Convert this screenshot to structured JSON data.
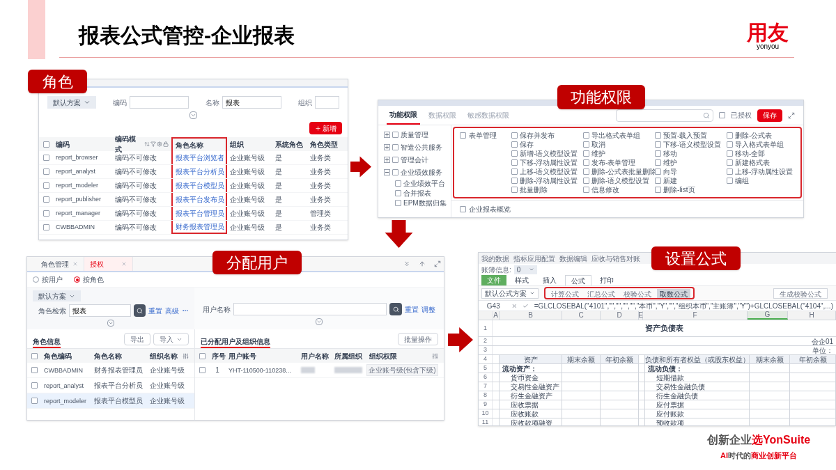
{
  "slide": {
    "title": "报表公式管控-企业报表",
    "logo": {
      "mark": "用友",
      "word": "yonyou"
    },
    "slogan": [
      [
        {
          "text": "创新企业",
          "accent": false
        },
        {
          "text": "选YonSuite",
          "accent": true
        }
      ],
      [
        {
          "text": "AI",
          "accent": true
        },
        {
          "text": "时代的",
          "accent": false
        },
        {
          "text": "商业创新平台",
          "accent": true
        }
      ]
    ]
  },
  "roles": {
    "label": "角色",
    "scheme": "默认方案",
    "filters": [
      {
        "label": "编码"
      },
      {
        "label": "名称",
        "value": "报表"
      },
      {
        "label": "组织"
      }
    ],
    "add_button": "新增",
    "all_checked": false,
    "columns": [
      "编码",
      "编码模式",
      "角色名称",
      "组织",
      "系统角色",
      "角色类型"
    ],
    "rows": [
      {
        "checked": false,
        "cells": [
          "report_browser",
          "编码不可修改",
          "报表平台浏览者",
          "企业账号级",
          "是",
          "业务类"
        ]
      },
      {
        "checked": false,
        "cells": [
          "report_analyst",
          "编码不可修改",
          "报表平台分析员",
          "企业账号级",
          "是",
          "业务类"
        ]
      },
      {
        "checked": false,
        "cells": [
          "report_modeler",
          "编码不可修改",
          "报表平台模型员",
          "企业账号级",
          "是",
          "业务类"
        ]
      },
      {
        "checked": false,
        "cells": [
          "report_publisher",
          "编码不可修改",
          "报表平台发布员",
          "企业账号级",
          "是",
          "业务类"
        ]
      },
      {
        "checked": false,
        "cells": [
          "report_manager",
          "编码不可修改",
          "报表平台管理员",
          "企业账号级",
          "是",
          "管理类"
        ]
      },
      {
        "checked": false,
        "cells": [
          "CWBBADMIN",
          "编码不可修改",
          "财务报表管理员",
          "企业账号级",
          "是",
          "业务类"
        ]
      }
    ]
  },
  "permissions": {
    "label": "功能权限",
    "tabs": [
      {
        "label": "功能权限",
        "selected": true
      },
      {
        "label": "数据权限",
        "selected": false
      },
      {
        "label": "敏感数据权限",
        "selected": false
      }
    ],
    "authorized_label": "已授权",
    "authorized_checked": false,
    "save_button": "保存",
    "tree": [
      {
        "label": "质量管理",
        "expanded": false,
        "checked": false
      },
      {
        "label": "智造公共服务",
        "expanded": false,
        "checked": false
      },
      {
        "label": "管理会计",
        "expanded": false,
        "checked": false
      },
      {
        "label": "企业绩效服务",
        "expanded": true,
        "checked": false,
        "children": [
          {
            "label": "企业绩效平台",
            "checked": false
          },
          {
            "label": "合并报表",
            "checked": false
          },
          {
            "label": "EPM数据归集",
            "checked": false
          }
        ]
      }
    ],
    "group": {
      "label": "表单管理",
      "checked": false,
      "columns": [
        [
          {
            "label": "保存并发布",
            "checked": false
          },
          {
            "label": "保存",
            "checked": false
          },
          {
            "label": "新增-语义模型设置",
            "checked": false
          },
          {
            "label": "下移-浮动属性设置",
            "checked": false
          },
          {
            "label": "上移-语义模型设置",
            "checked": false
          },
          {
            "label": "删除-浮动属性设置",
            "checked": false
          },
          {
            "label": "批量删除",
            "checked": false
          }
        ],
        [
          {
            "label": "导出格式表单组",
            "checked": false
          },
          {
            "label": "取消",
            "checked": false
          },
          {
            "label": "维护",
            "checked": false
          },
          {
            "label": "发布-表单管理",
            "checked": false
          },
          {
            "label": "删除-公式表批量删除",
            "checked": false
          },
          {
            "label": "删除-语义模型设置",
            "checked": false
          },
          {
            "label": "信息修改",
            "checked": false
          }
        ],
        [
          {
            "label": "预置-载入预置",
            "checked": false
          },
          {
            "label": "下移-语义模型设置",
            "checked": false
          },
          {
            "label": "移动",
            "checked": false
          },
          {
            "label": "维护",
            "checked": false
          },
          {
            "label": "向导",
            "checked": false
          },
          {
            "label": "新建",
            "checked": false
          },
          {
            "label": "删除-list页",
            "checked": false
          }
        ],
        [
          {
            "label": "删除-公式表",
            "checked": false
          },
          {
            "label": "导入格式表单组",
            "checked": false
          },
          {
            "label": "移动-全部",
            "checked": false
          },
          {
            "label": "新建格式表",
            "checked": false
          },
          {
            "label": "上移-浮动属性设置",
            "checked": false
          },
          {
            "label": "编组",
            "checked": false
          }
        ]
      ]
    },
    "next_group": {
      "label": "企业报表概览",
      "checked": false
    }
  },
  "assign": {
    "label": "分配用户",
    "tabs": [
      {
        "label": "角色管理",
        "selected": false
      },
      {
        "label": "授权",
        "selected": true
      }
    ],
    "modes": [
      {
        "label": "按用户",
        "selected": false
      },
      {
        "label": "按角色",
        "selected": true
      }
    ],
    "scheme": "默认方案",
    "role_search": {
      "label": "角色检索",
      "value": "报表"
    },
    "left_links": [
      "重置",
      "高级"
    ],
    "user_search": {
      "label": "用户名称"
    },
    "right_links": [
      "重置",
      "调整"
    ],
    "roles_title": "角色信息",
    "roles_buttons": [
      "导出",
      "导入"
    ],
    "roles_all_checked": false,
    "role_columns": [
      "角色编码",
      "角色名称",
      "组织名称"
    ],
    "role_rows": [
      {
        "cells": [
          "CWBBADMIN",
          "财务报表管理员",
          "企业账号级"
        ],
        "selected": false,
        "checked": false
      },
      {
        "cells": [
          "report_analyst",
          "报表平台分析员",
          "企业账号级"
        ],
        "selected": false,
        "checked": false
      },
      {
        "cells": [
          "report_modeler",
          "报表平台模型员",
          "企业账号级"
        ],
        "selected": true,
        "checked": false
      }
    ],
    "users_title": "已分配用户及组织信息",
    "users_button": "批量操作",
    "user_columns": [
      "序号",
      "用户账号",
      "用户名称",
      "所属组织",
      "组织权限"
    ],
    "users_all_checked": false,
    "user_rows": [
      {
        "index": "1",
        "account": "YHT-110500-110238...",
        "scope": "企业账号级(包含下级)",
        "checked": false
      }
    ]
  },
  "formula": {
    "label": "设置公式",
    "tabs": [
      "我的数据",
      "指标应用配置",
      "数据编辑",
      "应收与销售对账"
    ],
    "ledger": {
      "label": "账簿信息:",
      "value": "0"
    },
    "menu": [
      {
        "label": "文件",
        "kind": "file",
        "selected": false
      },
      {
        "label": "样式",
        "kind": "tab",
        "selected": false
      },
      {
        "label": "插入",
        "kind": "tab",
        "selected": false
      },
      {
        "label": "公式",
        "kind": "tab",
        "selected": true
      },
      {
        "label": "打印",
        "kind": "tab",
        "selected": false
      }
    ],
    "scheme": "默认公式方案",
    "formula_types": [
      {
        "label": "计算公式",
        "selected": false
      },
      {
        "label": "汇总公式",
        "selected": false
      },
      {
        "label": "校验公式",
        "selected": false
      },
      {
        "label": "取数公式",
        "selected": true
      }
    ],
    "generate_button": "生成校验公式",
    "cell_ref": "G43",
    "formula_text": "=GLCLOSEBAL(\"4101\",\"\",\"\",\"\",\"\",\"本币\",\"Y\",\"\",\"组织本币\",\"主账簿\",\"Y\")+GLCLOSEBAL(\"4104\",...)",
    "columns": [
      {
        "label": "A",
        "selected": false
      },
      {
        "label": "B",
        "selected": false
      },
      {
        "label": "C",
        "selected": false
      },
      {
        "label": "D",
        "selected": false
      },
      {
        "label": "E",
        "selected": false
      },
      {
        "label": "F",
        "selected": false
      },
      {
        "label": "G",
        "selected": true
      },
      {
        "label": "H",
        "selected": false
      }
    ],
    "row_numbers": [
      "1",
      "2",
      "3",
      "4",
      "5",
      "6",
      "7",
      "8",
      "9",
      "10",
      "11"
    ],
    "sheet_title": "资产负债表",
    "note": "会企01",
    "unit": "单位：",
    "header": [
      "资产",
      "期末余额",
      "年初余额",
      "负债和所有者权益（或股东权益）",
      "期末余额",
      "年初余额"
    ],
    "rows": [
      {
        "asset": "流动资产：",
        "liability": "流动负债："
      },
      {
        "asset": "货币资金",
        "liability": "短期借款"
      },
      {
        "asset": "交易性金融资产",
        "liability": "交易性金融负债"
      },
      {
        "asset": "衍生金融资产",
        "liability": "衍生金融负债"
      },
      {
        "asset": "应收票据",
        "liability": "应付票据"
      },
      {
        "asset": "应收账款",
        "liability": "应付账款"
      },
      {
        "asset": "应收款项融资",
        "liability": "预收款项"
      }
    ]
  }
}
